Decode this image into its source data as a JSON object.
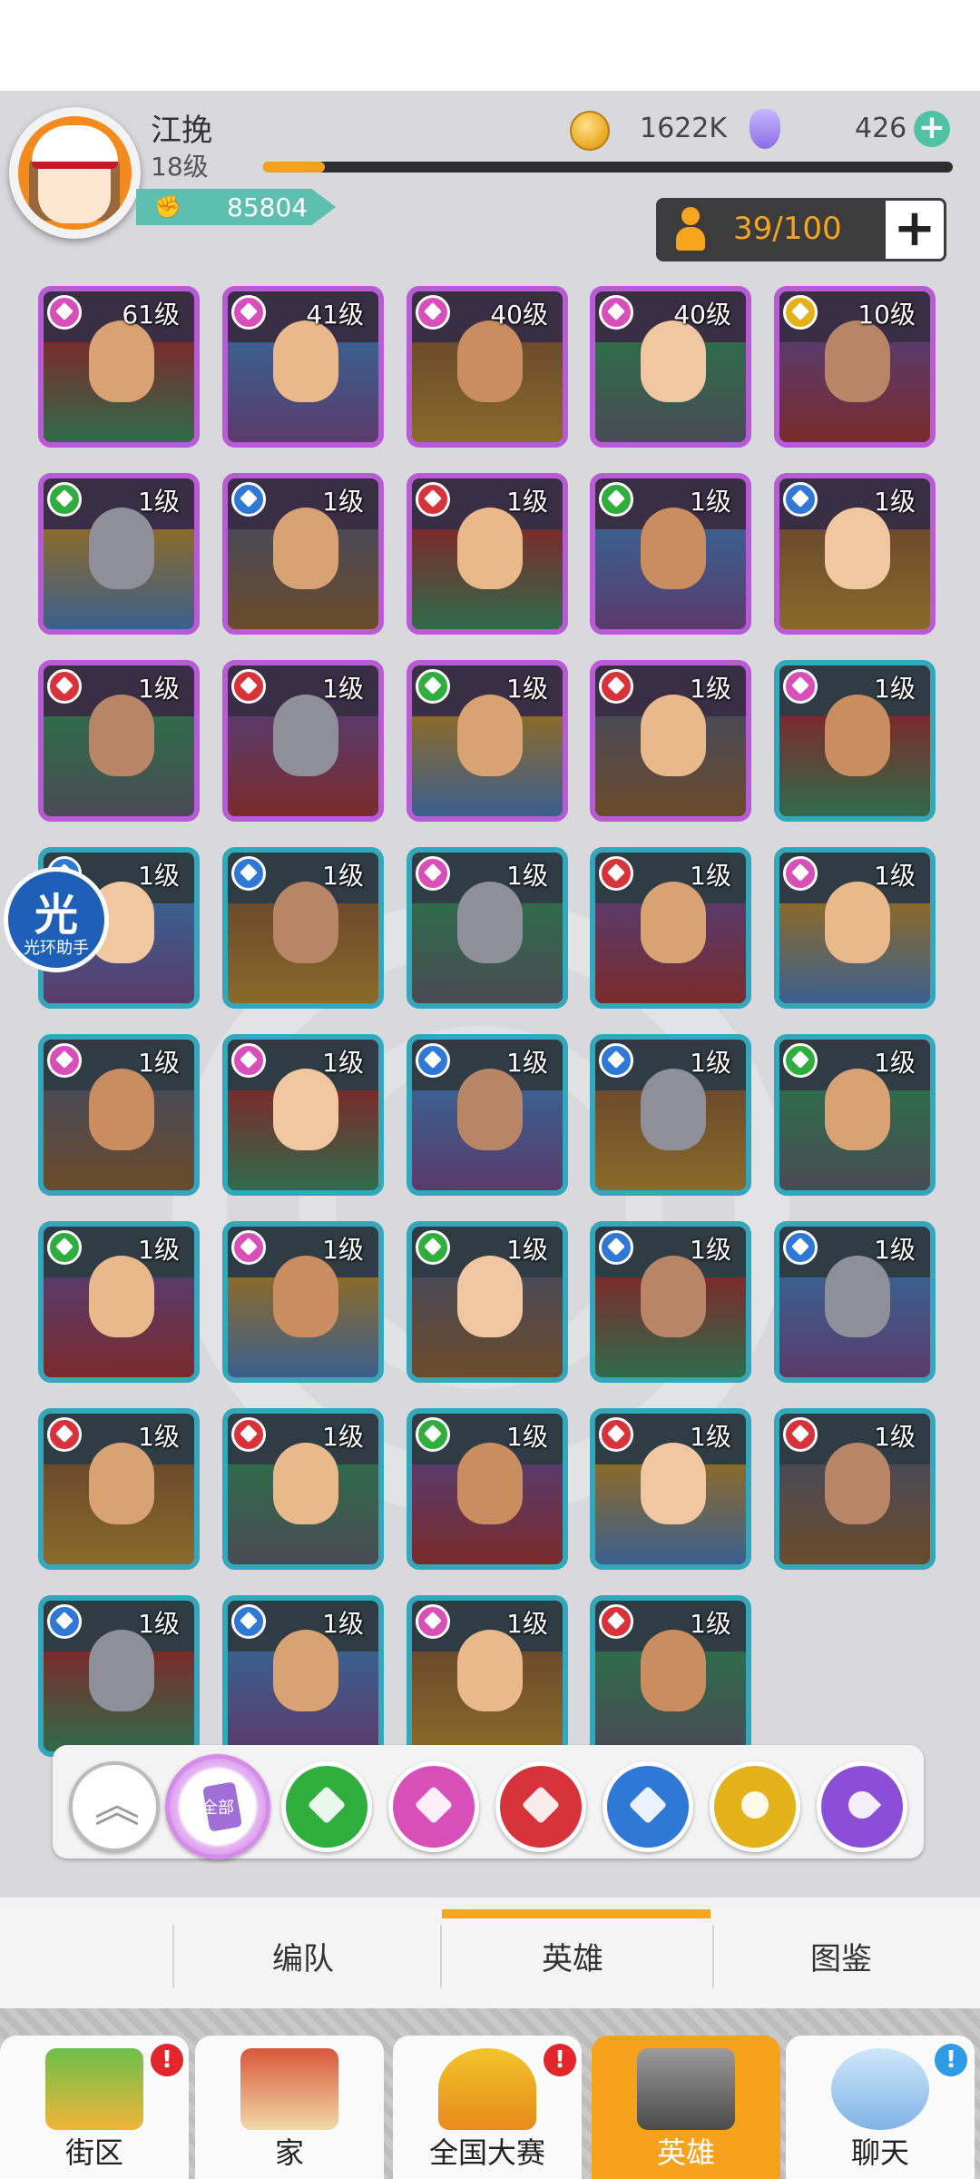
{
  "player": {
    "name": "江挽",
    "level": "18级",
    "power": "85804",
    "xp_progress": 0.09
  },
  "resources": {
    "gold": "1622K",
    "gems": "426",
    "gold_icon": "coin-icon",
    "gem_icon": "pacifier-gem-icon"
  },
  "hero_capacity": {
    "text": "39/100",
    "icon": "person-icon"
  },
  "colors": {
    "accent": "#f7a51f",
    "purple_frame": "#b95ad6",
    "teal_frame": "#33a8bc",
    "green": "#2fae3e",
    "pink": "#d94fb9",
    "red": "#d8323b",
    "blue": "#2f78d6",
    "gold": "#e3b21a",
    "violet": "#8a4fd6"
  },
  "heroes": [
    {
      "level": "61级",
      "element": "pink",
      "frame": "purple"
    },
    {
      "level": "41级",
      "element": "pink",
      "frame": "purple"
    },
    {
      "level": "40级",
      "element": "pink",
      "frame": "purple"
    },
    {
      "level": "40级",
      "element": "pink",
      "frame": "purple"
    },
    {
      "level": "10级",
      "element": "gold",
      "frame": "purple"
    },
    {
      "level": "1级",
      "element": "green",
      "frame": "purple"
    },
    {
      "level": "1级",
      "element": "blue",
      "frame": "purple"
    },
    {
      "level": "1级",
      "element": "red",
      "frame": "purple"
    },
    {
      "level": "1级",
      "element": "green",
      "frame": "purple"
    },
    {
      "level": "1级",
      "element": "blue",
      "frame": "purple"
    },
    {
      "level": "1级",
      "element": "red",
      "frame": "purple"
    },
    {
      "level": "1级",
      "element": "red",
      "frame": "purple"
    },
    {
      "level": "1级",
      "element": "green",
      "frame": "purple"
    },
    {
      "level": "1级",
      "element": "red",
      "frame": "purple"
    },
    {
      "level": "1级",
      "element": "pink",
      "frame": "teal"
    },
    {
      "level": "1级",
      "element": "blue",
      "frame": "teal"
    },
    {
      "level": "1级",
      "element": "blue",
      "frame": "teal"
    },
    {
      "level": "1级",
      "element": "pink",
      "frame": "teal"
    },
    {
      "level": "1级",
      "element": "red",
      "frame": "teal"
    },
    {
      "level": "1级",
      "element": "pink",
      "frame": "teal"
    },
    {
      "level": "1级",
      "element": "pink",
      "frame": "teal"
    },
    {
      "level": "1级",
      "element": "pink",
      "frame": "teal"
    },
    {
      "level": "1级",
      "element": "blue",
      "frame": "teal"
    },
    {
      "level": "1级",
      "element": "blue",
      "frame": "teal"
    },
    {
      "level": "1级",
      "element": "green",
      "frame": "teal"
    },
    {
      "level": "1级",
      "element": "green",
      "frame": "teal"
    },
    {
      "level": "1级",
      "element": "pink",
      "frame": "teal"
    },
    {
      "level": "1级",
      "element": "green",
      "frame": "teal"
    },
    {
      "level": "1级",
      "element": "blue",
      "frame": "teal"
    },
    {
      "level": "1级",
      "element": "blue",
      "frame": "teal"
    },
    {
      "level": "1级",
      "element": "red",
      "frame": "teal"
    },
    {
      "level": "1级",
      "element": "red",
      "frame": "teal"
    },
    {
      "level": "1级",
      "element": "green",
      "frame": "teal"
    },
    {
      "level": "1级",
      "element": "red",
      "frame": "teal"
    },
    {
      "level": "1级",
      "element": "red",
      "frame": "teal"
    },
    {
      "level": "1级",
      "element": "blue",
      "frame": "teal"
    },
    {
      "level": "1级",
      "element": "blue",
      "frame": "teal"
    },
    {
      "level": "1级",
      "element": "pink",
      "frame": "teal"
    },
    {
      "level": "1级",
      "element": "red",
      "frame": "teal"
    }
  ],
  "filters": [
    {
      "name": "collapse",
      "icon": "chevron-up-icon"
    },
    {
      "name": "all",
      "label": "全部",
      "icon": "all-cards-icon"
    },
    {
      "name": "green",
      "icon": "spade-icon"
    },
    {
      "name": "pink",
      "icon": "heart-icon"
    },
    {
      "name": "red",
      "icon": "club-icon"
    },
    {
      "name": "blue",
      "icon": "diamond-icon"
    },
    {
      "name": "gold",
      "icon": "sun-icon"
    },
    {
      "name": "violet",
      "icon": "moon-icon"
    }
  ],
  "tabs": {
    "formation": "编队",
    "heroes": "英雄",
    "codex": "图鉴",
    "active": "heroes"
  },
  "nav": [
    {
      "label": "街区",
      "badge": "!",
      "badge_color": "red",
      "icon": "street-sign-icon"
    },
    {
      "label": "家",
      "icon": "house-icon"
    },
    {
      "label": "全国大赛",
      "badge": "!",
      "badge_color": "red",
      "icon": "trophy-icon"
    },
    {
      "label": "英雄",
      "active": true,
      "icon": "hero-cards-icon"
    },
    {
      "label": "聊天",
      "badge": "!",
      "badge_color": "blue",
      "icon": "chat-bubble-icon"
    }
  ],
  "helper": {
    "big": "光",
    "small": "光环助手"
  }
}
